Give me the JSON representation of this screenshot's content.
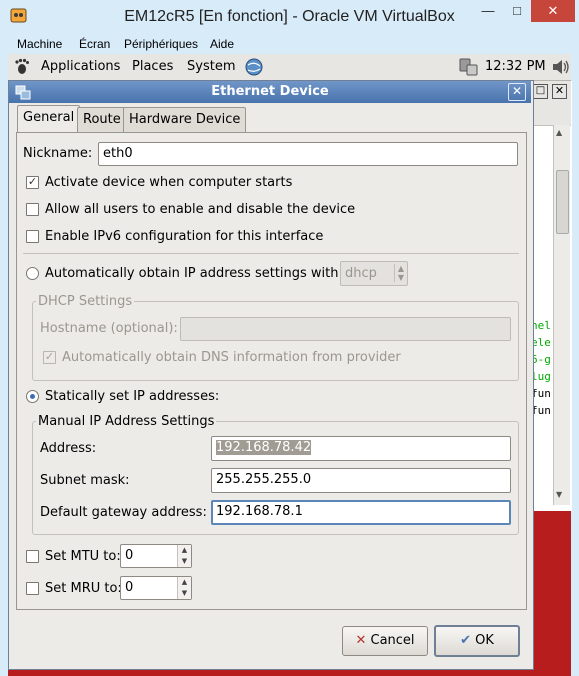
{
  "host": {
    "title": "EM12cR5 [En fonction] - Oracle VM VirtualBox",
    "menu": [
      "Machine",
      "Écran",
      "Périphériques",
      "Aide"
    ],
    "minimize": "—",
    "maximize": "□",
    "close": "✕"
  },
  "panel": {
    "applications": "Applications",
    "places": "Places",
    "system": "System",
    "clock": "12:32 PM"
  },
  "terminal": {
    "lines": [
      "nel",
      "ele",
      "6-g",
      "lug",
      "fun",
      "fun"
    ]
  },
  "dialog": {
    "title": "Ethernet Device",
    "tabs": [
      "General",
      "Route",
      "Hardware Device"
    ],
    "nickname_label": "Nickname:",
    "nickname_value": "eth0",
    "activate_label": "Activate device when computer starts",
    "allow_users_label": "Allow all users to enable and disable the device",
    "ipv6_label": "Enable IPv6 configuration for this interface",
    "auto_ip_label": "Automatically obtain IP address settings with:",
    "auto_ip_method": "dhcp",
    "dhcp_settings_label": "DHCP Settings",
    "hostname_label": "Hostname (optional):",
    "hostname_value": "",
    "auto_dns_label": "Automatically obtain DNS information from provider",
    "static_label": "Statically set IP addresses:",
    "manual_settings_label": "Manual IP Address Settings",
    "address_label": "Address:",
    "address_value": "192.168.78.42",
    "subnet_label": "Subnet mask:",
    "subnet_value": "255.255.255.0",
    "gateway_label": "Default gateway address:",
    "gateway_value": "192.168.78.1",
    "mtu_label": "Set MTU to:",
    "mtu_value": "0",
    "mru_label": "Set MRU to:",
    "mru_value": "0",
    "cancel_label": "Cancel",
    "ok_label": "OK"
  },
  "colors": {
    "accent": "#4873ad",
    "desktop_red": "#b81d1d"
  }
}
